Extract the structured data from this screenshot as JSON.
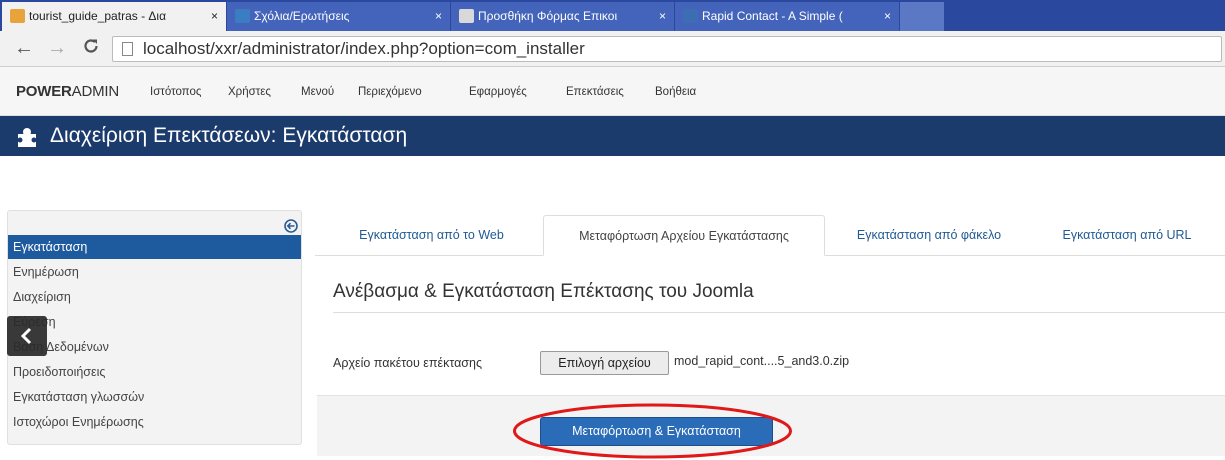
{
  "browser": {
    "tabs": [
      {
        "title": "tourist_guide_patras - Δια",
        "close": "×",
        "favicon": "joomla-icon",
        "color": "#e8a33b",
        "active": true
      },
      {
        "title": "Σχόλια/Ερωτήσεις",
        "close": "×",
        "favicon": "joomla-icon",
        "color": "#3a7dc2",
        "active": false
      },
      {
        "title": "Προσθήκη Φόρμας Επικοι",
        "close": "×",
        "favicon": "page-icon",
        "color": "#d9d9d9",
        "active": false
      },
      {
        "title": "Rapid Contact - A Simple (",
        "close": "×",
        "favicon": "rapid-icon",
        "color": "#3d6db3",
        "active": false
      }
    ],
    "url": "localhost/xxr/administrator/index.php?option=com_installer",
    "icons": {
      "back": "back-arrow-icon",
      "forward": "forward-arrow-icon",
      "reload": "reload-icon"
    }
  },
  "adminbar": {
    "brand_bold": "POWER",
    "brand_rest": "ADMIN",
    "menu": [
      "Ιστότοπος",
      "Χρήστες",
      "Μενού",
      "Περιεχόμενο",
      "Εφαρμογές",
      "Επεκτάσεις",
      "Βοήθεια"
    ]
  },
  "titlebar": {
    "icon": "puzzle-icon",
    "title": "Διαχείριση Επεκτάσεων: Εγκατάσταση",
    "background": "#1b3b6c"
  },
  "sidebar": {
    "collapse_icon": "circle-arrow-left-icon",
    "items": [
      {
        "label": "Εγκατάσταση",
        "active": true
      },
      {
        "label": "Ενημέρωση",
        "active": false
      },
      {
        "label": "Διαχείριση",
        "active": false
      },
      {
        "label": "Εύρεση",
        "active": false
      },
      {
        "label": "Βάση Δεδομένων",
        "active": false
      },
      {
        "label": "Προειδοποιήσεις",
        "active": false
      },
      {
        "label": "Εγκατάσταση γλωσσών",
        "active": false
      },
      {
        "label": "Ιστοχώροι Ενημέρωσης",
        "active": false
      }
    ],
    "overlay_icon": "chevron-left-icon",
    "active_color": "#1e5a9e"
  },
  "tabs": [
    {
      "label": "Εγκατάσταση από το Web",
      "active": false
    },
    {
      "label": "Μεταφόρτωση Αρχείου Εγκατάστασης",
      "active": true
    },
    {
      "label": "Εγκατάσταση από φάκελο",
      "active": false
    },
    {
      "label": "Εγκατάσταση από URL",
      "active": false
    }
  ],
  "upload": {
    "heading": "Ανέβασμα & Εγκατάσταση Επέκτασης του Joomla",
    "file_label": "Αρχείο πακέτου επέκτασης",
    "choose_button": "Επιλογή αρχείου",
    "file_name": "mod_rapid_cont....5_and3.0.zip",
    "submit_button": "Μεταφόρτωση & Εγκατάσταση",
    "button_color": "#2b6cb8",
    "highlight_color": "#e01818"
  }
}
